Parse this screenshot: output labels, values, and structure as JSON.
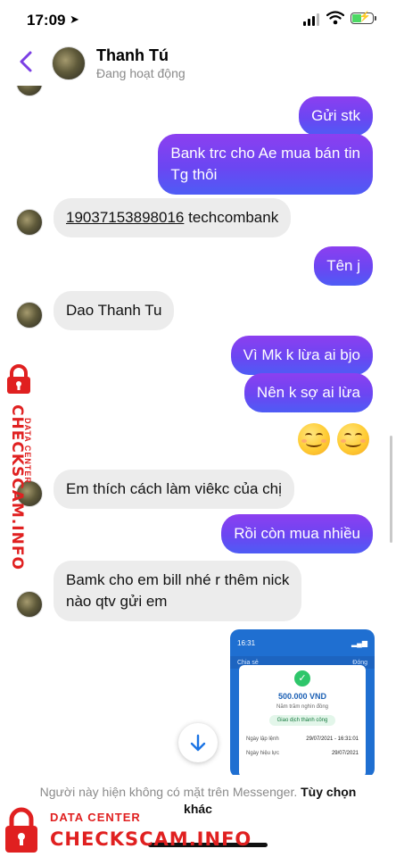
{
  "status_bar": {
    "time": "17:09",
    "battery_level": 0.45
  },
  "header": {
    "contact_name": "Thanh Tú",
    "contact_status": "Đang hoạt động"
  },
  "messages": [
    {
      "dir": "out",
      "text": "Gửi stk"
    },
    {
      "dir": "out",
      "text_lines": [
        "Bank trc cho Ae mua bán tin",
        "Tg thôi"
      ]
    },
    {
      "dir": "in",
      "account_number": "19037153898016",
      "bank": "techcombank"
    },
    {
      "dir": "out",
      "text": "Tên j"
    },
    {
      "dir": "in",
      "text": "Dao Thanh Tu"
    },
    {
      "dir": "out",
      "text": "Vì Mk k lừa ai bjo"
    },
    {
      "dir": "out",
      "text": "Nên k sợ ai lừa"
    },
    {
      "dir": "out",
      "emoji": [
        "smiling-face",
        "smiling-face"
      ]
    },
    {
      "dir": "in",
      "text": "Em thích cách làm viêkc của chị"
    },
    {
      "dir": "out",
      "text": "Rồi còn mua nhiều"
    },
    {
      "dir": "in",
      "text_lines": [
        "Bamk cho em bill nhé r thêm nick",
        "nào qtv gửi em"
      ]
    }
  ],
  "receipt": {
    "time": "16:31",
    "back_label": "Chia sẻ",
    "done_label": "Đóng",
    "amount": "500.000 VND",
    "amount_words": "Năm trăm nghìn đồng",
    "status": "Giao dịch thành công",
    "rows": [
      {
        "label": "Ngày lập lệnh",
        "value": "29/07/2021 - 16:31:01"
      },
      {
        "label": "Ngày hiệu lực",
        "value": "29/07/2021"
      }
    ]
  },
  "footer": {
    "notice": "Người này hiện không có mặt trên Messenger.",
    "link": "Tùy chọn khác"
  },
  "watermark": {
    "sub": "DATA CENTER",
    "main": "CHECKSCAM.INFO"
  },
  "colors": {
    "outgoing_start": "#8c3ff0",
    "outgoing_end": "#4e5cf5",
    "incoming": "#ececec",
    "watermark": "#e02020"
  }
}
